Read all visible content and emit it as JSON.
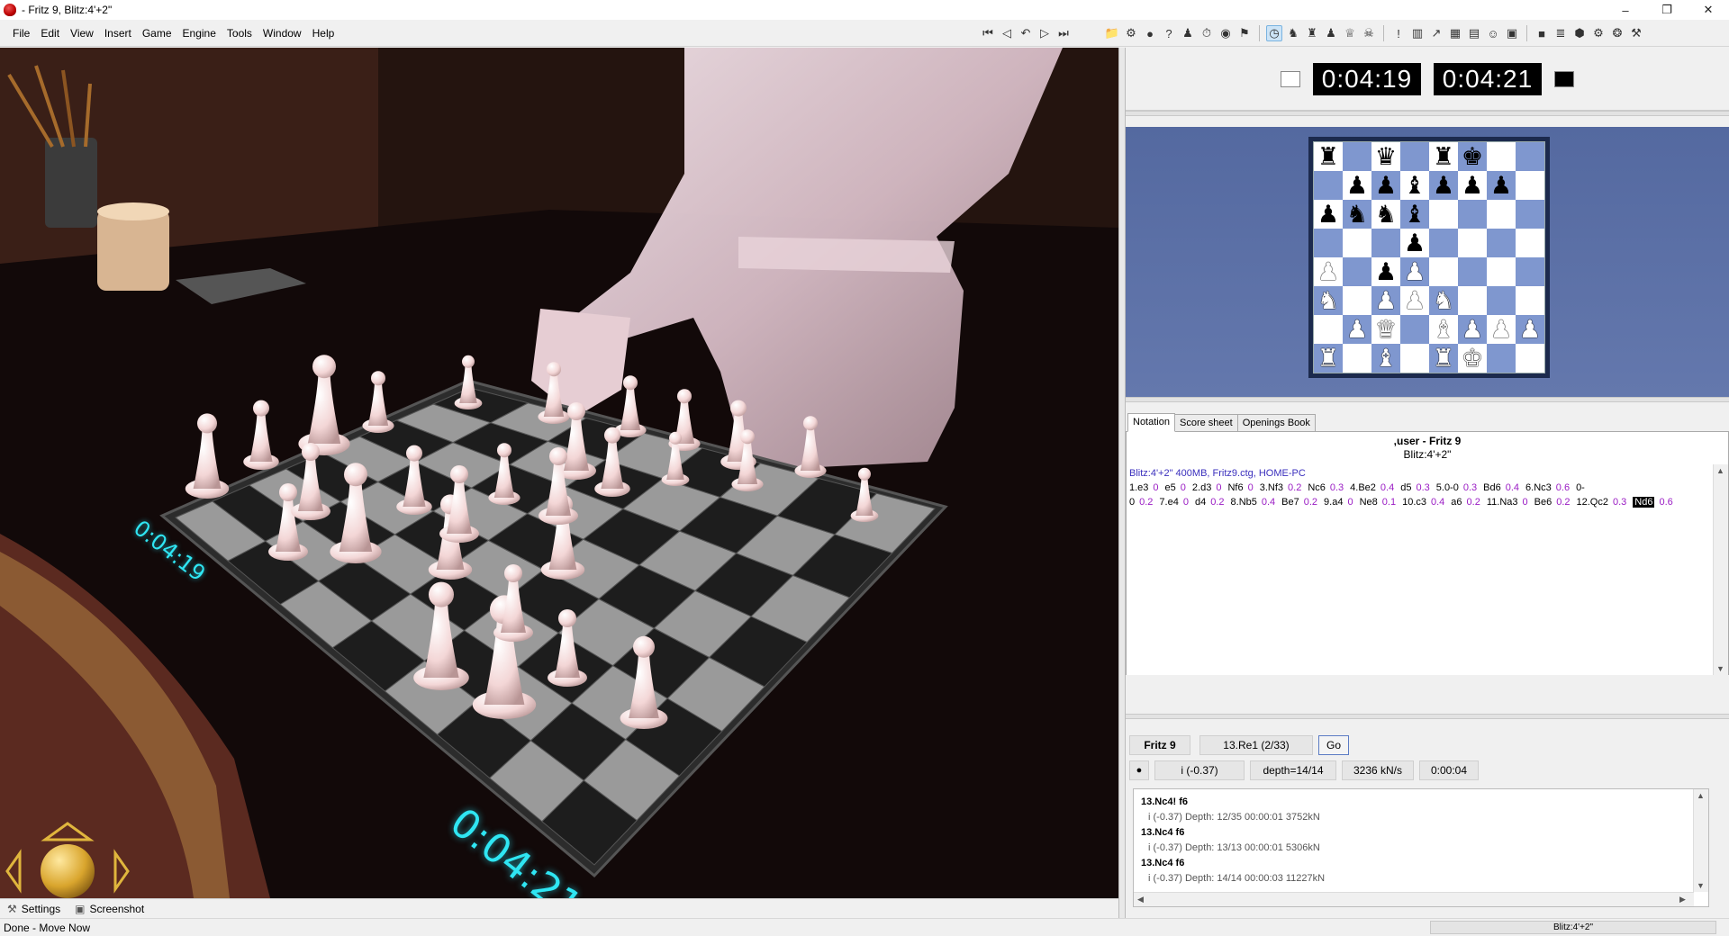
{
  "window": {
    "title": "- Fritz 9, Blitz:4'+2\""
  },
  "menu": [
    "File",
    "Edit",
    "View",
    "Insert",
    "Game",
    "Engine",
    "Tools",
    "Window",
    "Help"
  ],
  "clocks": {
    "white": "0:04:19",
    "black": "0:04:21"
  },
  "clocks3d": {
    "near_left": "0:04:19",
    "near_front": "0:04:21"
  },
  "board": {
    "ranks": [
      [
        "r",
        "",
        "q",
        "",
        "r",
        "k",
        "",
        ""
      ],
      [
        "",
        "p",
        "p",
        "b",
        "p",
        "p",
        "p",
        ""
      ],
      [
        "p",
        "n",
        "n",
        "b",
        "",
        "",
        "",
        ""
      ],
      [
        "",
        "",
        "",
        "p",
        "",
        "",
        "",
        ""
      ],
      [
        "P",
        "",
        "p",
        "P",
        "",
        "",
        "",
        ""
      ],
      [
        "N",
        "",
        "P",
        "P",
        "N",
        "",
        "",
        ""
      ],
      [
        "",
        "P",
        "Q",
        "",
        "B",
        "P",
        "P",
        "P"
      ],
      [
        "R",
        "",
        "B",
        "",
        "R",
        "K",
        "",
        ""
      ]
    ]
  },
  "tabs": [
    "Notation",
    "Score sheet",
    "Openings Book"
  ],
  "game": {
    "title": ",user - Fritz 9",
    "subtitle": "Blitz:4'+2\"",
    "meta": "Blitz:4'+2\"  400MB, Fritz9.ctg, HOME-PC",
    "moves": [
      {
        "m": "1.e3",
        "e": "0"
      },
      {
        "m": "e5",
        "e": "0"
      },
      {
        "m": "2.d3",
        "e": "0"
      },
      {
        "m": "Nf6",
        "e": "0"
      },
      {
        "m": "3.Nf3",
        "e": "0.2"
      },
      {
        "m": "Nc6",
        "e": "0.3"
      },
      {
        "m": "4.Be2",
        "e": "0.4"
      },
      {
        "m": "d5",
        "e": "0.3"
      },
      {
        "m": "5.0-0",
        "e": "0.3"
      },
      {
        "m": "Bd6",
        "e": "0.4"
      },
      {
        "m": "6.Nc3",
        "e": "0.6"
      },
      {
        "m": "0-0",
        "e": "0.2"
      },
      {
        "m": "7.e4",
        "e": "0"
      },
      {
        "m": "d4",
        "e": "0.2"
      },
      {
        "m": "8.Nb5",
        "e": "0.4"
      },
      {
        "m": "Be7",
        "e": "0.2"
      },
      {
        "m": "9.a4",
        "e": "0"
      },
      {
        "m": "Ne8",
        "e": "0.1"
      },
      {
        "m": "10.c3",
        "e": "0.4"
      },
      {
        "m": "a6",
        "e": "0.2"
      },
      {
        "m": "11.Na3",
        "e": "0"
      },
      {
        "m": "Be6",
        "e": "0.2"
      },
      {
        "m": "12.Qc2",
        "e": "0.3"
      },
      {
        "m": "Nd6",
        "e": "0.6"
      }
    ]
  },
  "engine": {
    "name": "Fritz 9",
    "current_move": "13.Re1 (2/33)",
    "go_label": "Go",
    "eval": "i  (-0.37)",
    "depth": "depth=14/14",
    "speed": "3236 kN/s",
    "time": "0:00:04",
    "lines": [
      {
        "main": "13.Nc4! f6",
        "sub": "i  (-0.37)   Depth: 12/35    00:00:01  3752kN"
      },
      {
        "main": "13.Nc4 f6",
        "sub": "i  (-0.37)   Depth: 13/13    00:00:01  5306kN"
      },
      {
        "main": "13.Nc4 f6",
        "sub": "i  (-0.37)   Depth: 14/14    00:00:03  11227kN"
      }
    ]
  },
  "bottom_strip": {
    "settings": "Settings",
    "screenshot": "Screenshot"
  },
  "status": {
    "left": "Done - Move Now",
    "right": "Blitz:4'+2\""
  }
}
